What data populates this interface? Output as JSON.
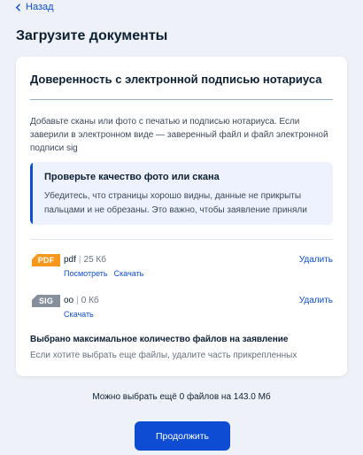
{
  "nav": {
    "back_label": "Назад"
  },
  "page": {
    "title": "Загрузите документы"
  },
  "card": {
    "title": "Доверенность с электронной подписью нотариуса",
    "description": "Добавьте сканы или фото с печатью и подписью нотариуса. Если заверили в электронном виде — заверенный файл и файл электронной подписи sig",
    "notice": {
      "title": "Проверьте качество фото или скана",
      "text": "Убедитесь, что страницы хорошо видны, данные не прикрыты пальцами и не обрезаны. Это важно, чтобы заявление приняли"
    },
    "files": [
      {
        "badge": "PDF",
        "badge_color": "#f7981d",
        "name": "pdf",
        "separator": "|",
        "size": "25 Кб",
        "actions": [
          "Посмотреть",
          "Скачать"
        ],
        "delete_label": "Удалить"
      },
      {
        "badge": "SIG",
        "badge_color": "#86909c",
        "name": "oo",
        "separator": "|",
        "size": "0 Кб",
        "actions": [
          "Скачать"
        ],
        "delete_label": "Удалить"
      }
    ],
    "limit": {
      "title": "Выбрано максимальное количество файлов на заявление",
      "subtitle": "Если хотите выбрать еще файлы, удалите часть прикрепленных"
    }
  },
  "footer": {
    "remaining_text": "Можно выбрать ещё 0 файлов на 143.0 Мб",
    "continue_label": "Продолжить"
  },
  "colors": {
    "background": "#eef2f8",
    "accent": "#0d4cd3",
    "notice_background": "#edf2fe",
    "text_primary": "#0b1f33",
    "text_secondary": "#66727f"
  },
  "icons": {
    "back": "chevron-left-icon"
  }
}
